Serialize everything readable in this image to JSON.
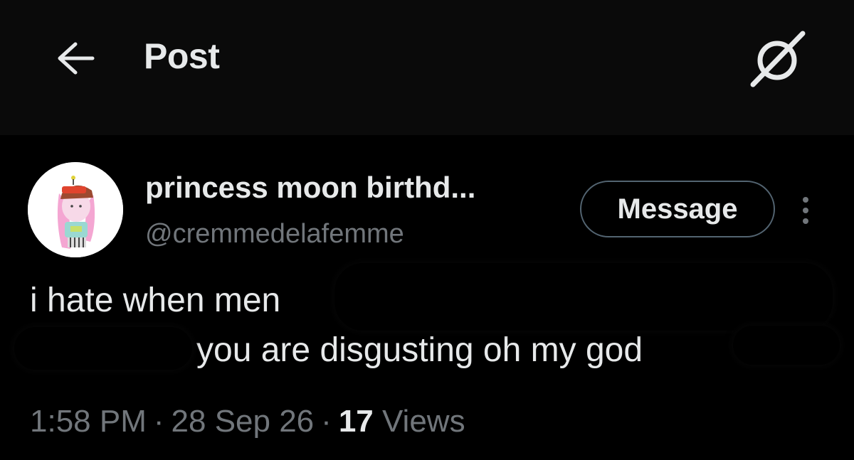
{
  "header": {
    "title": "Post",
    "back_icon": "arrow-left-icon",
    "grok_icon": "grok-icon"
  },
  "post": {
    "author": {
      "display_name": "princess moon birthd...",
      "handle": "@cremmedelafemme",
      "avatar_icon": "avatar-illustration"
    },
    "message_button_label": "Message",
    "more_icon": "more-vertical-icon",
    "text": {
      "line1": "i hate when men",
      "line2": "you are disgusting oh my god"
    },
    "meta": {
      "time": "1:58 PM",
      "separator": "·",
      "date": "28 Sep 26",
      "views_count": "17",
      "views_label": "Views"
    }
  },
  "colors": {
    "background": "#000000",
    "header_background": "#0a0a0a",
    "primary_text": "#e7e9ea",
    "secondary_text": "#71767b",
    "button_border": "#536471"
  }
}
